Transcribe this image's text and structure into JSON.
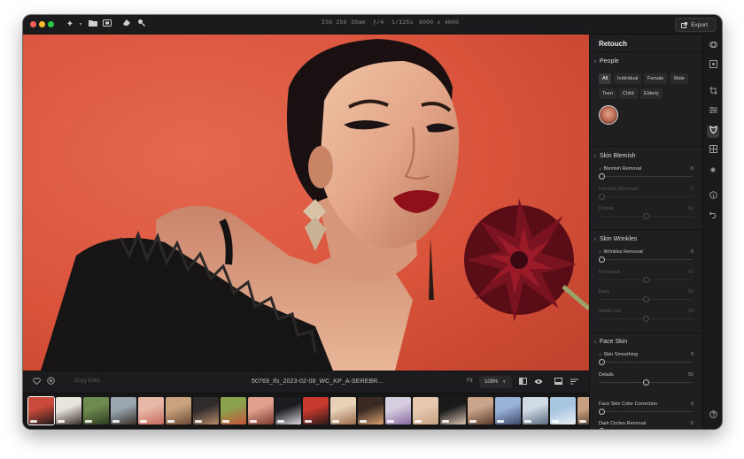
{
  "topbar": {
    "iso": "ISO 250",
    "focal": "35mm",
    "aperture": "ƒ/4",
    "shutter": "1/125s",
    "dimensions": "6000 x 4000",
    "export_label": "Export"
  },
  "toolbar": {
    "copy_edits": "Copy Edits",
    "filename": "50769_Ifs_2023-02-08_WC_KP_A-SEREBR...",
    "fit": "Fit",
    "zoom": "109%"
  },
  "panel": {
    "title": "Retouch",
    "people": {
      "title": "People",
      "chips": [
        "All",
        "Individual",
        "Female",
        "Male",
        "Teen",
        "Child",
        "Elderly"
      ]
    },
    "skin_blemish": {
      "title": "Skin Blemish",
      "blemish_removal": {
        "label": "Blemish Removal",
        "value": "0"
      },
      "freckles_removal": {
        "label": "Freckles Removal",
        "value": "0"
      },
      "details": {
        "label": "Details",
        "value": "50"
      }
    },
    "skin_wrinkles": {
      "title": "Skin Wrinkles",
      "wrinkles_removal": {
        "label": "Wrinkles Removal",
        "value": "0"
      },
      "forehead": {
        "label": "Forehead",
        "value": "50"
      },
      "eyes": {
        "label": "Eyes",
        "value": "50"
      },
      "smile_line": {
        "label": "Smile Line",
        "value": "50"
      }
    },
    "face_skin": {
      "title": "Face Skin",
      "skin_smoothing": {
        "label": "Skin Smoothing",
        "value": "0"
      },
      "details": {
        "label": "Details",
        "value": "50"
      },
      "face_skin_color_correction": {
        "label": "Face Skin Color Correction",
        "value": "0"
      },
      "dark_circles_removal": {
        "label": "Dark Circles Removal",
        "value": "0"
      }
    }
  },
  "filmstrip": {
    "thumbs": [
      {
        "colors": [
          "#c94a3a",
          "#1d1a1a"
        ]
      },
      {
        "colors": [
          "#e8e4de",
          "#3a2e28"
        ]
      },
      {
        "colors": [
          "#6f8a4e",
          "#2d3a20"
        ]
      },
      {
        "colors": [
          "#9aa7b0",
          "#3a2f2a"
        ]
      },
      {
        "colors": [
          "#e7b7a8",
          "#c96a5a"
        ]
      },
      {
        "colors": [
          "#c9a27e",
          "#6a4a35"
        ]
      },
      {
        "colors": [
          "#2f2b2b",
          "#b78a6a"
        ]
      },
      {
        "colors": [
          "#8aa24c",
          "#c9533c"
        ]
      },
      {
        "colors": [
          "#e0a08e",
          "#7a3a2e"
        ]
      },
      {
        "colors": [
          "#1c1c20",
          "#d8d8de"
        ]
      },
      {
        "colors": [
          "#c9392e",
          "#2a1a1a"
        ]
      },
      {
        "colors": [
          "#e8d2b8",
          "#9a6a4a"
        ]
      },
      {
        "colors": [
          "#3a2a22",
          "#d9a070"
        ]
      },
      {
        "colors": [
          "#d6cde0",
          "#8a6aa0"
        ]
      },
      {
        "colors": [
          "#e6c9b0",
          "#c7a080"
        ]
      },
      {
        "colors": [
          "#1a1a1a",
          "#d8c4b0"
        ]
      },
      {
        "colors": [
          "#c9a48a",
          "#5a3a2a"
        ]
      },
      {
        "colors": [
          "#9ab2d8",
          "#3a4a6a"
        ]
      },
      {
        "colors": [
          "#d0dbe6",
          "#5a6a80"
        ]
      },
      {
        "colors": [
          "#a7c6e0",
          "#e8eef4"
        ]
      },
      {
        "colors": [
          "#c9a080",
          "#3a2a20"
        ]
      }
    ]
  },
  "icons": {
    "topbar": [
      "magic-wand-icon",
      "folder-icon",
      "album-icon",
      "eraser-icon",
      "search-icon"
    ],
    "toolbar_left": [
      "heart-icon",
      "close-circle-icon"
    ],
    "toolbar_right": [
      "compare-icon",
      "eye-icon",
      "filmstrip-icon",
      "sort-icon"
    ],
    "rail": [
      "overlay-icon",
      "scan-icon",
      "crop-icon",
      "adjust-icon",
      "retouch-icon",
      "layers-icon",
      "spark-icon",
      "info-icon",
      "undo-icon",
      "help-icon"
    ]
  },
  "colors": {
    "accent_bg": "#d9553d",
    "panel_bg": "#1f1f21"
  }
}
